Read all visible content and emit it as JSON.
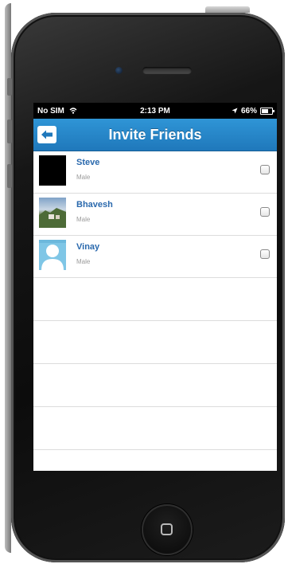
{
  "status_bar": {
    "carrier": "No SIM",
    "time": "2:13 PM",
    "battery": "66%"
  },
  "nav": {
    "title": "Invite Friends",
    "back_icon": "back-arrow-icon"
  },
  "friends": [
    {
      "name": "Steve",
      "gender": "Male",
      "avatar": "black-photo",
      "checked": false
    },
    {
      "name": "Bhavesh",
      "gender": "Male",
      "avatar": "landscape-photo",
      "checked": false
    },
    {
      "name": "Vinay",
      "gender": "Male",
      "avatar": "default-person-icon",
      "checked": false
    }
  ],
  "colors": {
    "nav_bar": "#2a8acb",
    "name_text": "#2a69ad"
  }
}
